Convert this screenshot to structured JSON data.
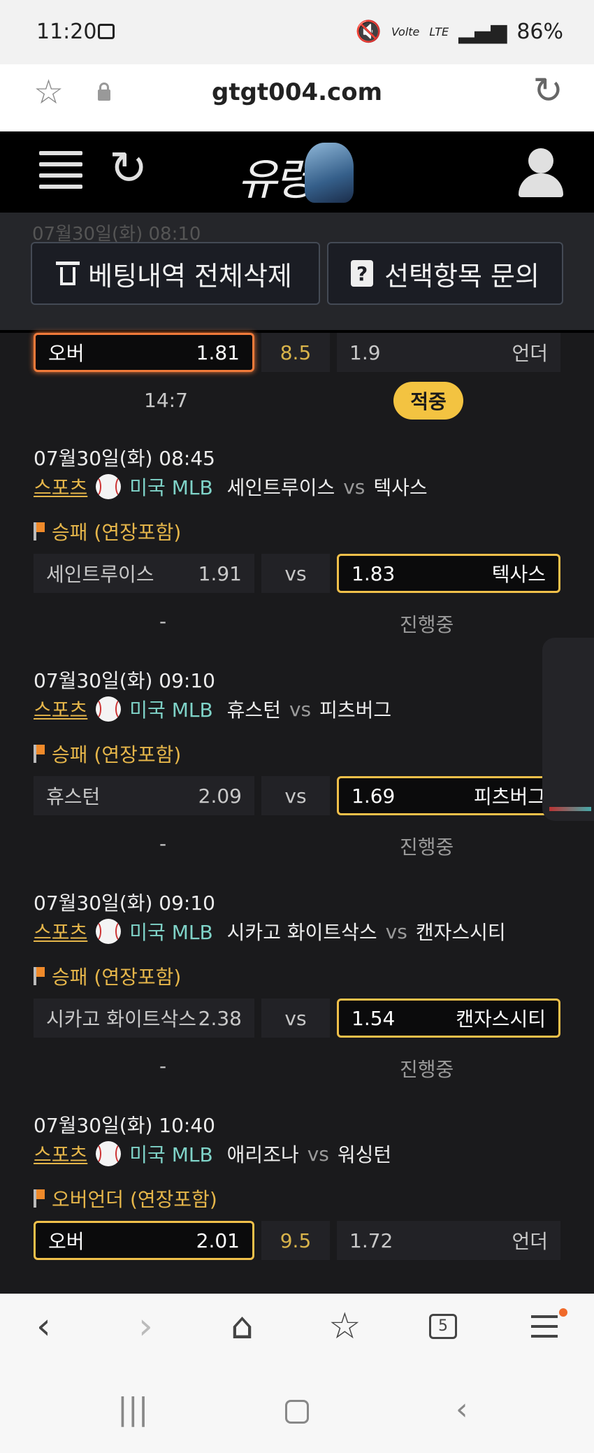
{
  "status_bar": {
    "time": "11:20",
    "lte": "LTE",
    "battery": "86%",
    "volte": "Volte"
  },
  "browser": {
    "url": "gtgt004.com",
    "tabs_count": "5"
  },
  "site": {
    "logo_text": "유령"
  },
  "toolbar": {
    "delete_all_label": "베팅내역 전체삭제",
    "inquiry_label": "선택항목 문의"
  },
  "top_partial": {
    "date_fragment": "07월30일(화) 08:10",
    "over_label": "오버",
    "over_odds": "1.81",
    "line": "8.5",
    "under_odds": "1.9",
    "under_label": "언더",
    "score": "14:7",
    "result_badge": "적중"
  },
  "bets": [
    {
      "datetime": "07월30일(화) 08:45",
      "sport": "스포츠",
      "league": "미국 MLB",
      "home": "세인트루이스",
      "vs": "vs",
      "away": "텍사스",
      "market": "승패 (연장포함)",
      "left_label": "세인트루이스",
      "left_odds": "1.91",
      "mid": "vs",
      "right_odds": "1.83",
      "right_label": "텍사스",
      "score": "-",
      "status": "진행중"
    },
    {
      "datetime": "07월30일(화) 09:10",
      "sport": "스포츠",
      "league": "미국 MLB",
      "home": "휴스턴",
      "vs": "vs",
      "away": "피츠버그",
      "market": "승패 (연장포함)",
      "left_label": "휴스턴",
      "left_odds": "2.09",
      "mid": "vs",
      "right_odds": "1.69",
      "right_label": "피츠버그",
      "score": "-",
      "status": "진행중"
    },
    {
      "datetime": "07월30일(화) 09:10",
      "sport": "스포츠",
      "league": "미국 MLB",
      "home": "시카고 화이트삭스",
      "vs": "vs",
      "away": "캔자스시티",
      "market": "승패 (연장포함)",
      "left_label": "시카고 화이트삭스",
      "left_odds": "2.38",
      "mid": "vs",
      "right_odds": "1.54",
      "right_label": "캔자스시티",
      "score": "-",
      "status": "진행중"
    },
    {
      "datetime": "07월30일(화) 10:40",
      "sport": "스포츠",
      "league": "미국 MLB",
      "home": "애리조나",
      "vs": "vs",
      "away": "워싱턴",
      "market": "오버언더 (연장포함)",
      "left_label": "오버",
      "left_odds": "2.01",
      "mid": "9.5",
      "right_odds": "1.72",
      "right_label": "언더"
    }
  ],
  "colors": {
    "accent": "#f0c04a",
    "league": "#7fd3c8",
    "sport": "#e6b64a",
    "background": "#1a1a1c"
  }
}
